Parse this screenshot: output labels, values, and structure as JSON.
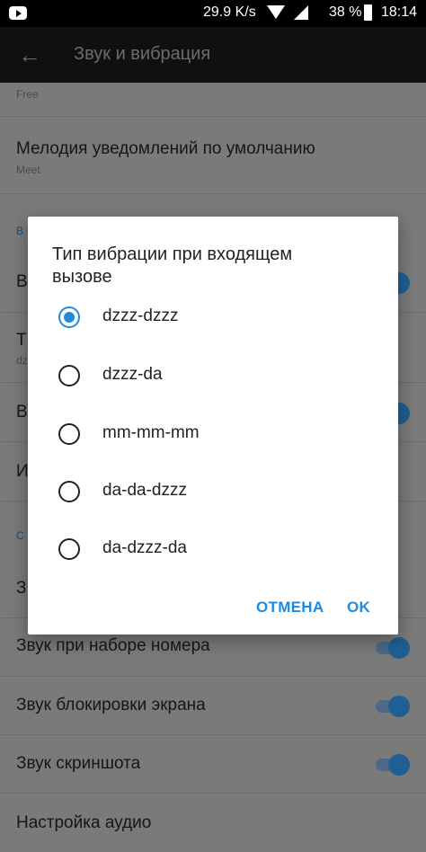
{
  "status_bar": {
    "speed": "29.9 K/s",
    "battery": "38 %",
    "time": "18:14"
  },
  "app_bar": {
    "title": "Звук и вибрация"
  },
  "list": {
    "partial_top_sub": "Free",
    "ringtone_title": "Мелодия уведомлений по умолчанию",
    "ringtone_sub": "Meet",
    "section_1_partial": "В",
    "row_hidden_1": "В",
    "row_hidden_2_title": "Т",
    "row_hidden_2_sub": "dz",
    "row_hidden_3": "В",
    "row_hidden_4": "И",
    "section_2_partial": "С",
    "row_hidden_5": "З",
    "dial_sound": "Звук при наборе номера",
    "lock_sound": "Звук блокировки экрана",
    "screenshot_sound": "Звук скриншота",
    "audio_settings": "Настройка аудио"
  },
  "dialog": {
    "title": "Тип вибрации при входящем вызове",
    "options": [
      "dzzz-dzzz",
      "dzzz-da",
      "mm-mm-mm",
      "da-da-dzzz",
      "da-dzzz-da"
    ],
    "selected_index": 0,
    "cancel_label": "ОТМЕНА",
    "ok_label": "OK"
  },
  "colors": {
    "accent": "#1e8ae0",
    "status_bar_bg": "#000000",
    "scrim_bg": "#7a7a7a"
  }
}
